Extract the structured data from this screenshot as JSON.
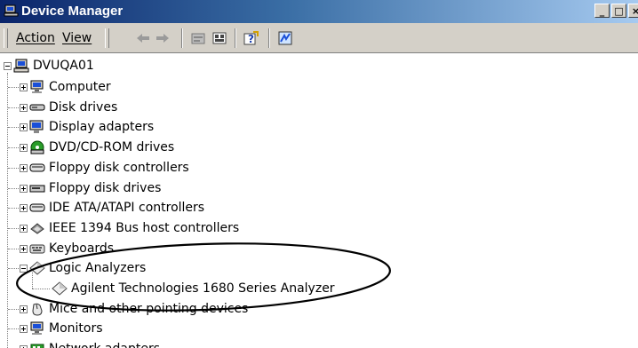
{
  "window": {
    "title": "Device Manager",
    "icon": "computer-management-icon",
    "controls": [
      "minimize",
      "maximize",
      "close"
    ]
  },
  "menubar": {
    "items": [
      {
        "label": "Action",
        "accel": "A"
      },
      {
        "label": "View",
        "accel": "V"
      }
    ]
  },
  "toolbar": {
    "buttons": [
      "back-arrow-icon",
      "forward-arrow-icon",
      "properties-icon",
      "grid-view-icon",
      "help-icon",
      "scan-hardware-icon"
    ]
  },
  "tree": {
    "root": {
      "label": "DVUQA01",
      "icon": "computer-icon",
      "expanded": true
    },
    "nodes": [
      {
        "label": "Computer",
        "icon": "monitor-icon",
        "expanded": false
      },
      {
        "label": "Disk drives",
        "icon": "disk-drive-icon",
        "expanded": false
      },
      {
        "label": "Display adapters",
        "icon": "display-adapter-icon",
        "expanded": false
      },
      {
        "label": "DVD/CD-ROM drives",
        "icon": "dvd-drive-icon",
        "expanded": false
      },
      {
        "label": "Floppy disk controllers",
        "icon": "controller-icon",
        "expanded": false
      },
      {
        "label": "Floppy disk drives",
        "icon": "floppy-drive-icon",
        "expanded": false
      },
      {
        "label": "IDE ATA/ATAPI controllers",
        "icon": "controller-icon",
        "expanded": false
      },
      {
        "label": "IEEE 1394 Bus host controllers",
        "icon": "ieee1394-icon",
        "expanded": false
      },
      {
        "label": "Keyboards",
        "icon": "keyboard-icon",
        "expanded": false
      },
      {
        "label": "Logic Analyzers",
        "icon": "diamond-icon",
        "expanded": true,
        "children": [
          {
            "label": "Agilent Technologies 1680 Series Analyzer",
            "icon": "diamond-icon"
          }
        ]
      },
      {
        "label": "Mice and other pointing devices",
        "icon": "mouse-icon",
        "expanded": false
      },
      {
        "label": "Monitors",
        "icon": "monitor-icon",
        "expanded": false
      },
      {
        "label": "Network adapters",
        "icon": "network-adapter-icon",
        "expanded": false
      }
    ]
  },
  "annotation": {
    "shape": "ellipse",
    "color": "#000000"
  }
}
